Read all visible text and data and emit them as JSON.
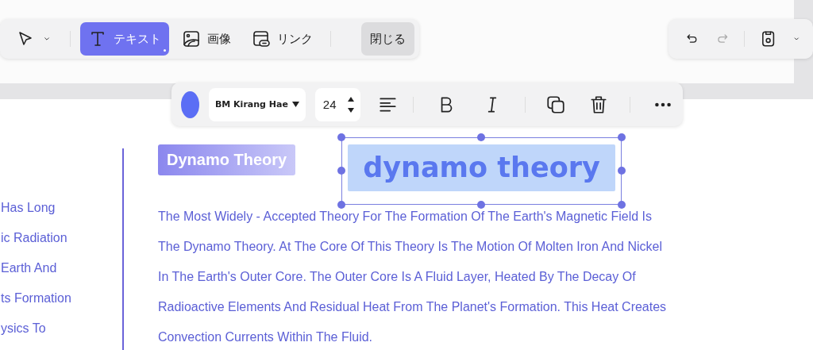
{
  "toolbar": {
    "tools": [
      {
        "kind": "pointer",
        "selected": false
      },
      {
        "kind": "text",
        "label": "テキスト",
        "selected": true
      },
      {
        "kind": "image",
        "label": "画像",
        "selected": false
      },
      {
        "kind": "link",
        "label": "リンク",
        "selected": false
      }
    ],
    "close_button": "閉じる"
  },
  "history": {
    "undo": {
      "disabled": false
    },
    "redo": {
      "disabled": true
    }
  },
  "format_bar": {
    "color": "#5b6ef5",
    "font": "BM Kirang Hae",
    "size": "24"
  },
  "page": {
    "left_lines": [
      "Has Long",
      "ic Radiation",
      "Earth And",
      "ts Formation",
      "ysics To"
    ],
    "heading": "Dynamo Theory",
    "selected_text": "dynamo theory",
    "paragraph_lines": [
      "The Most Widely - Accepted Theory For The Formation Of The Earth's Magnetic Field Is",
      "The Dynamo Theory. At The Core Of This Theory Is The Motion Of Molten Iron And Nickel",
      "In The Earth's Outer Core. The Outer Core Is A Fluid Layer, Heated By The Decay Of",
      "Radioactive Elements And Residual Heat From The Planet's Formation. This Heat Creates",
      "Convection Currents Within The Fluid."
    ]
  }
}
